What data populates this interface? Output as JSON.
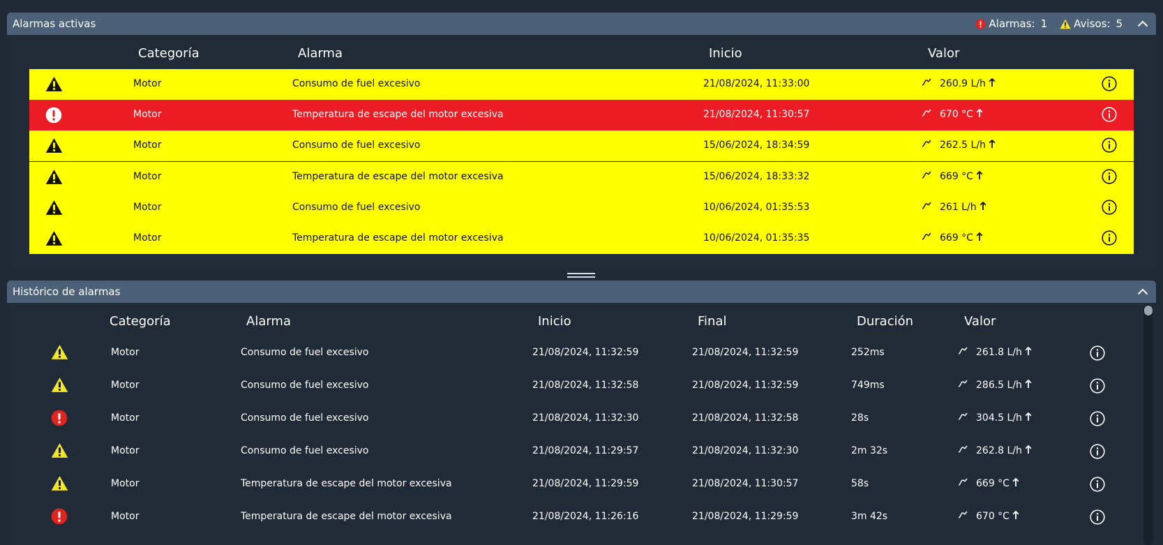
{
  "active_panel": {
    "title": "Alarmas activas",
    "alarms_label": "Alarmas:",
    "alarms_count": "1",
    "warnings_label": "Avisos:",
    "warnings_count": "5",
    "columns": {
      "category": "Categoría",
      "alarm": "Alarma",
      "start": "Inicio",
      "value": "Valor"
    },
    "rows": [
      {
        "severity": "warning",
        "category": "Motor",
        "alarm": "Consumo de fuel excesivo",
        "start": "21/08/2024, 11:33:00",
        "value": "260.9 L/h"
      },
      {
        "severity": "alarm",
        "category": "Motor",
        "alarm": "Temperatura de escape del motor excesiva",
        "start": "21/08/2024, 11:30:57",
        "value": "670 °C"
      },
      {
        "severity": "warning",
        "category": "Motor",
        "alarm": "Consumo de fuel excesivo",
        "start": "15/06/2024, 18:34:59",
        "value": "262.5 L/h"
      },
      {
        "severity": "warning",
        "category": "Motor",
        "alarm": "Temperatura de escape del motor excesiva",
        "start": "15/06/2024, 18:33:32",
        "value": "669 °C"
      },
      {
        "severity": "warning",
        "category": "Motor",
        "alarm": "Consumo de fuel excesivo",
        "start": "10/06/2024, 01:35:53",
        "value": "261 L/h"
      },
      {
        "severity": "warning",
        "category": "Motor",
        "alarm": "Temperatura de escape del motor excesiva",
        "start": "10/06/2024, 01:35:35",
        "value": "669 °C"
      }
    ]
  },
  "history_panel": {
    "title": "Histórico de alarmas",
    "columns": {
      "category": "Categoría",
      "alarm": "Alarma",
      "start": "Inicio",
      "end": "Final",
      "duration": "Duración",
      "value": "Valor"
    },
    "rows": [
      {
        "severity": "warning",
        "category": "Motor",
        "alarm": "Consumo de fuel excesivo",
        "start": "21/08/2024, 11:32:59",
        "end": "21/08/2024, 11:32:59",
        "duration": "252ms",
        "value": "261.8 L/h"
      },
      {
        "severity": "warning",
        "category": "Motor",
        "alarm": "Consumo de fuel excesivo",
        "start": "21/08/2024, 11:32:58",
        "end": "21/08/2024, 11:32:59",
        "duration": "749ms",
        "value": "286.5 L/h"
      },
      {
        "severity": "alarm",
        "category": "Motor",
        "alarm": "Consumo de fuel excesivo",
        "start": "21/08/2024, 11:32:30",
        "end": "21/08/2024, 11:32:58",
        "duration": "28s",
        "value": "304.5 L/h"
      },
      {
        "severity": "warning",
        "category": "Motor",
        "alarm": "Consumo de fuel excesivo",
        "start": "21/08/2024, 11:29:57",
        "end": "21/08/2024, 11:32:30",
        "duration": "2m 32s",
        "value": "262.8 L/h"
      },
      {
        "severity": "warning",
        "category": "Motor",
        "alarm": "Temperatura de escape del motor excesiva",
        "start": "21/08/2024, 11:29:59",
        "end": "21/08/2024, 11:30:57",
        "duration": "58s",
        "value": "669 °C"
      },
      {
        "severity": "alarm",
        "category": "Motor",
        "alarm": "Temperatura de escape del motor excesiva",
        "start": "21/08/2024, 11:26:16",
        "end": "21/08/2024, 11:29:59",
        "duration": "3m 42s",
        "value": "670 °C"
      }
    ]
  },
  "colors": {
    "warning_bg": "#ffff00",
    "alarm_bg": "#ec1c24",
    "header_bg": "#4c6178",
    "page_bg": "#212b37",
    "warning_icon": "#f2e529",
    "alarm_icon": "#e0241f"
  },
  "icons": {
    "warning": "warning-triangle-icon",
    "alarm": "alarm-exclamation-icon",
    "trend": "trend-icon",
    "rising": "arrow-up-icon",
    "info": "info-icon",
    "collapse": "chevron-up-icon"
  }
}
